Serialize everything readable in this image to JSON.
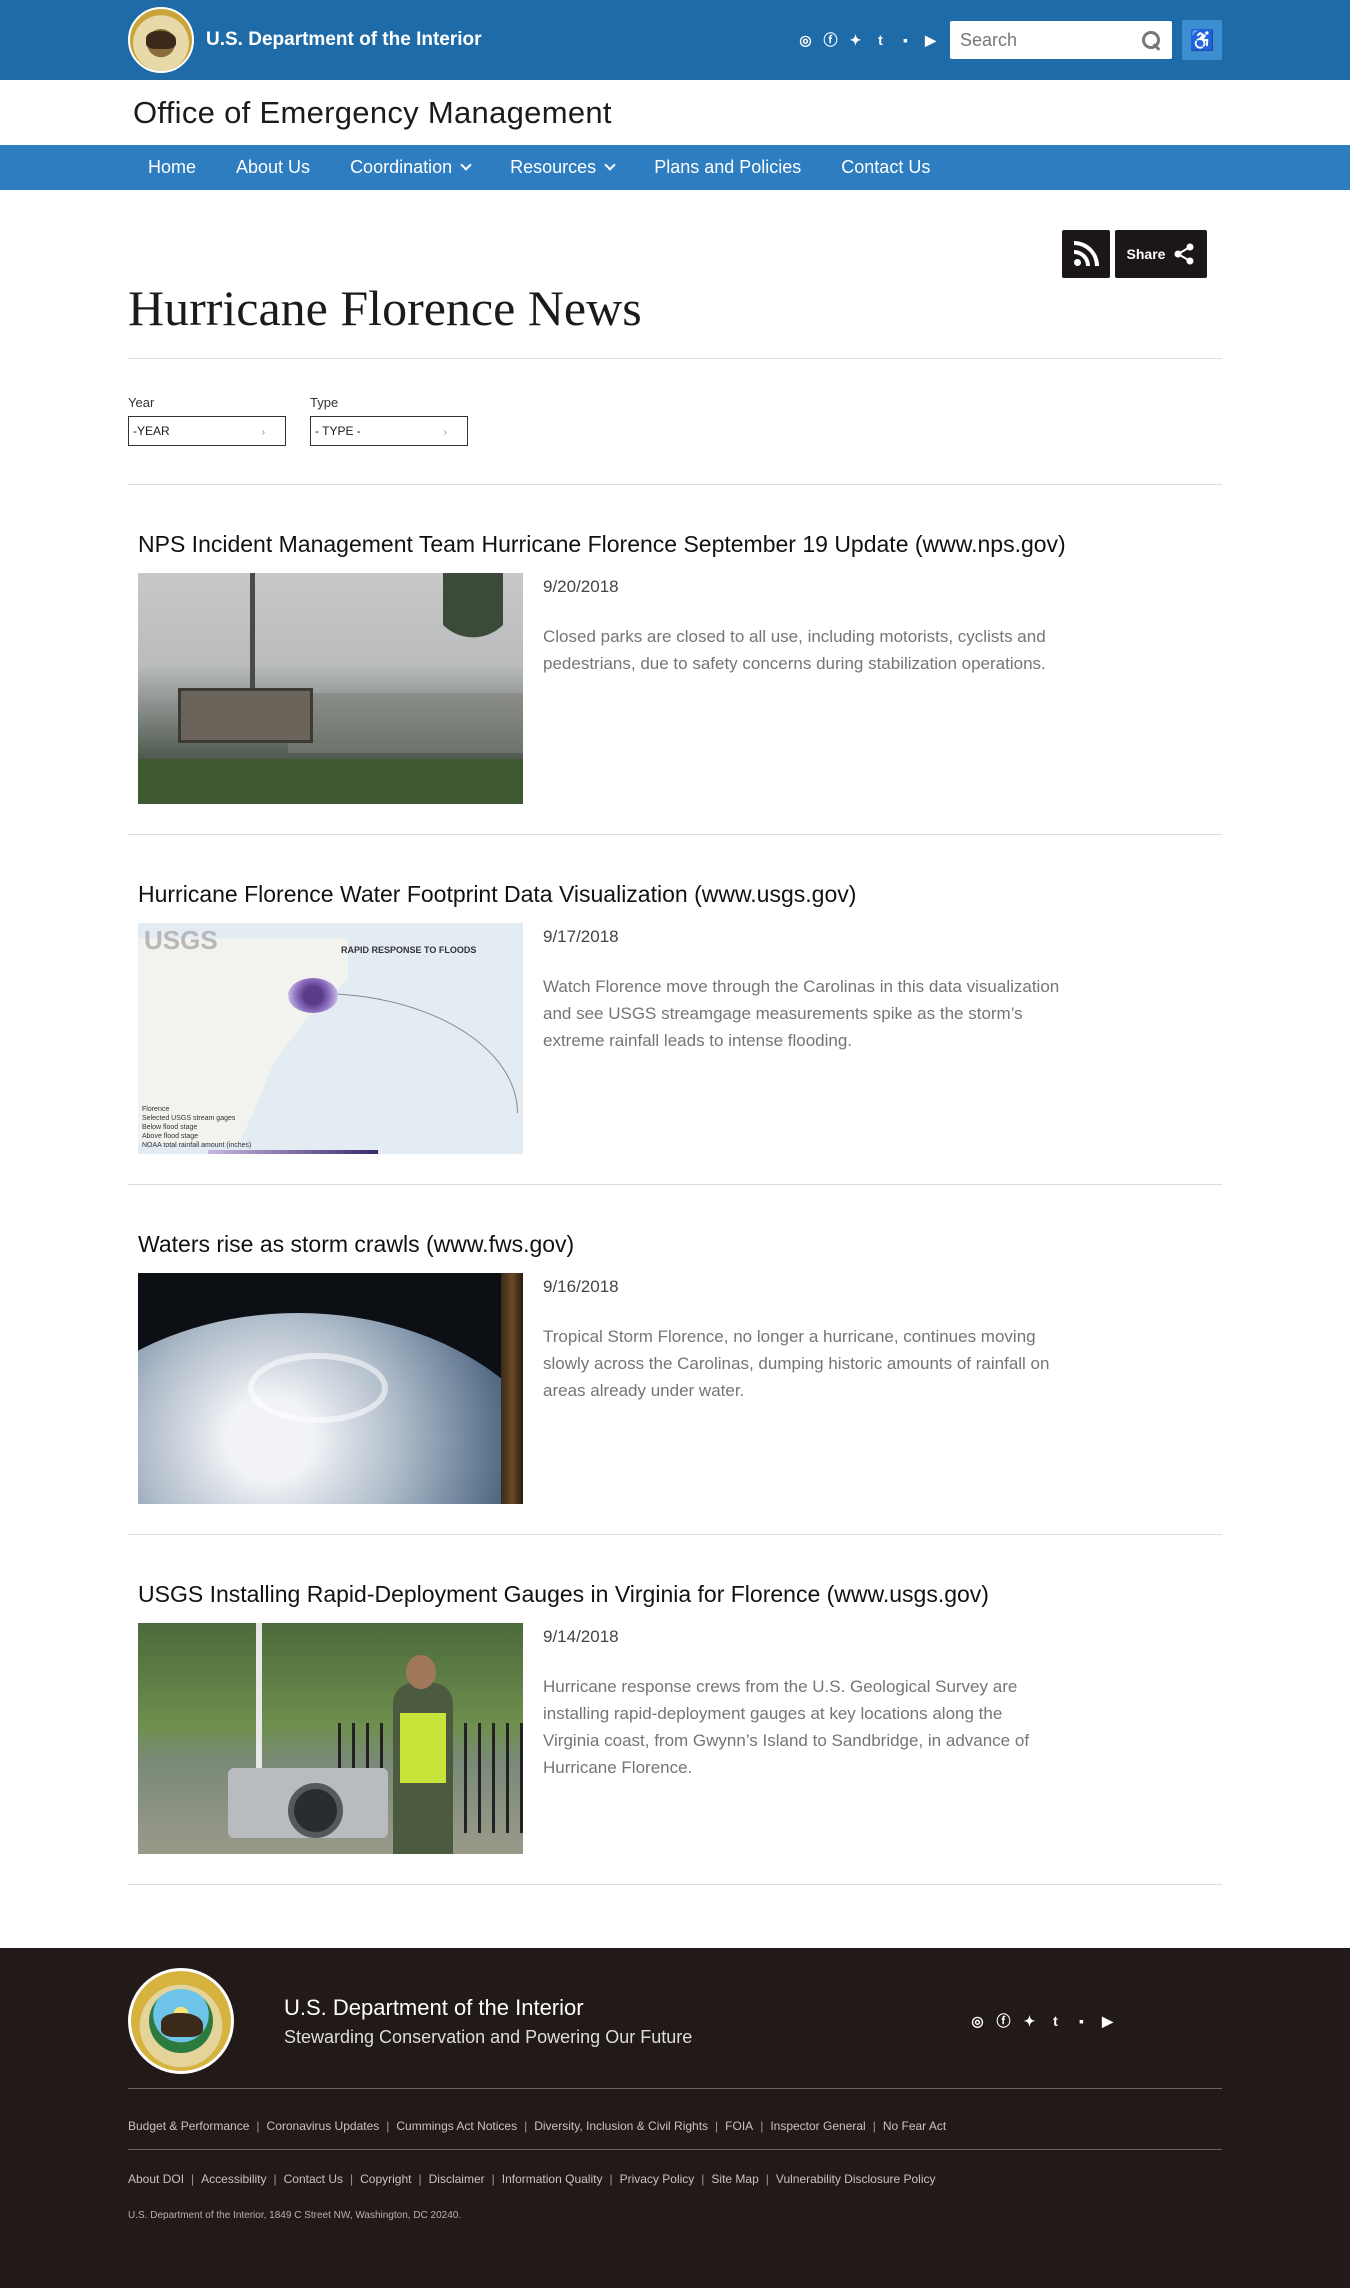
{
  "header": {
    "agency": "U.S. Department of the Interior",
    "search_placeholder": "Search",
    "social_icons": [
      "instagram-icon",
      "facebook-icon",
      "twitter-icon",
      "tumblr-icon",
      "flickr-icon",
      "youtube-icon"
    ],
    "accessibility_icon": "wheelchair-icon"
  },
  "office": {
    "title": "Office of Emergency Management"
  },
  "nav": {
    "items": [
      {
        "label": "Home",
        "has_dropdown": false
      },
      {
        "label": "About Us",
        "has_dropdown": false
      },
      {
        "label": "Coordination",
        "has_dropdown": true
      },
      {
        "label": "Resources",
        "has_dropdown": true
      },
      {
        "label": "Plans and Policies",
        "has_dropdown": false
      },
      {
        "label": "Contact Us",
        "has_dropdown": false
      }
    ]
  },
  "tools": {
    "share_label": "Share"
  },
  "page": {
    "title": "Hurricane Florence News"
  },
  "filters": {
    "year": {
      "label": "Year",
      "value": "-YEAR"
    },
    "type": {
      "label": "Type",
      "value": "- TYPE -"
    }
  },
  "articles": [
    {
      "title": "NPS Incident Management Team Hurricane Florence September 19 Update (www.nps.gov)",
      "date": "9/20/2018",
      "summary": "Closed parks are closed to all use, including motorists, cyclists and pedestrians, due to safety concerns during stabilization operations."
    },
    {
      "title": "Hurricane Florence Water Footprint Data Visualization (www.usgs.gov)",
      "date": "9/17/2018",
      "summary": "Watch Florence move through the Carolinas in this data visualization and see USGS streamgage measurements spike as the storm’s extreme rainfall leads to intense flooding.",
      "thumb_text": {
        "logo": "USGS",
        "heading": "RAPID RESPONSE TO FLOODS",
        "legend": "Florence\nSelected USGS stream gages\nBelow flood stage\nAbove flood stage\nNOAA total rainfall amount (inches)"
      }
    },
    {
      "title": "Waters rise as storm crawls (www.fws.gov)",
      "date": "9/16/2018",
      "summary": "Tropical Storm Florence, no longer a hurricane, continues moving slowly across the Carolinas, dumping historic amounts of rainfall on areas already under water."
    },
    {
      "title": "USGS Installing Rapid-Deployment Gauges in Virginia for Florence (www.usgs.gov)",
      "date": "9/14/2018",
      "summary": "Hurricane response crews from the U.S. Geological Survey are installing rapid-deployment gauges at key locations along the Virginia coast, from Gwynn’s Island to Sandbridge, in advance of Hurricane Florence."
    }
  ],
  "footer": {
    "agency": "U.S. Department of the Interior",
    "tagline": "Stewarding Conservation and Powering Our Future",
    "links_row1": [
      "Budget & Performance",
      "Coronavirus Updates",
      "Cummings Act Notices",
      "Diversity, Inclusion & Civil Rights",
      "FOIA",
      "Inspector General",
      "No Fear Act"
    ],
    "links_row2": [
      "About DOI",
      "Accessibility",
      "Contact Us",
      "Copyright",
      "Disclaimer",
      "Information Quality",
      "Privacy Policy",
      "Site Map",
      "Vulnerability Disclosure Policy"
    ],
    "address": "U.S. Department of the Interior, 1849 C Street NW, Washington, DC 20240."
  }
}
